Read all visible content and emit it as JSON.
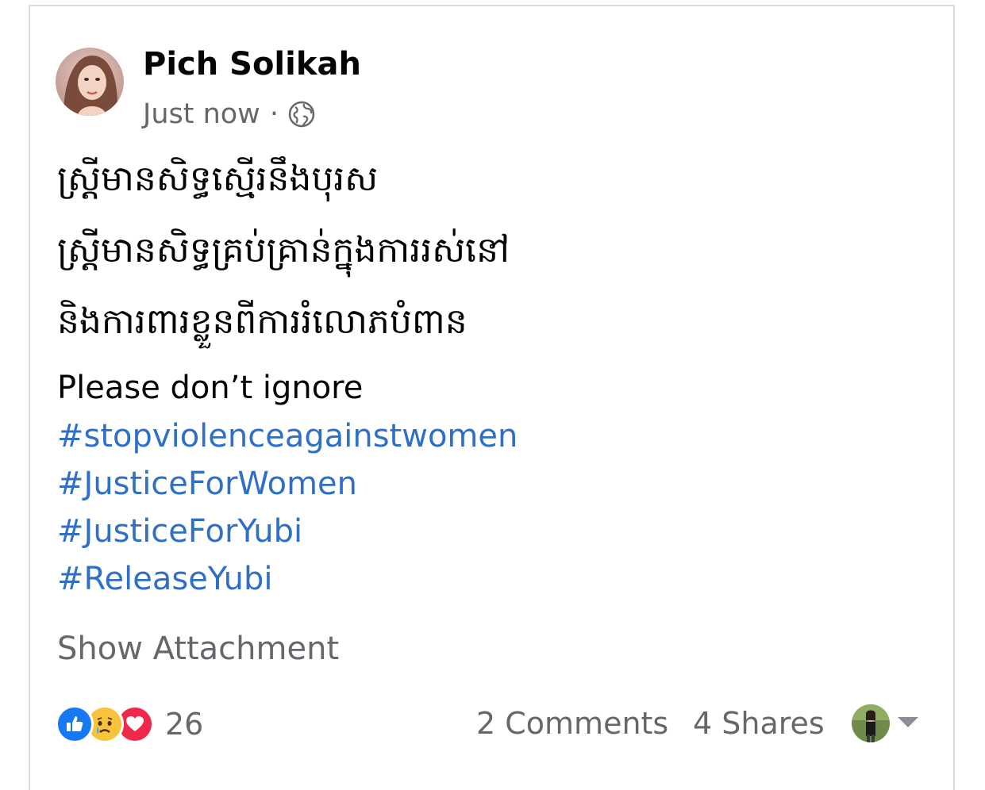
{
  "post": {
    "author": "Pich Solikah",
    "timestamp": "Just now",
    "separator": "·",
    "privacy_icon": "globe-icon",
    "body_khmer": [
      "ស្ត្រីមានសិទ្ធស្មើរនឹងបុរស",
      "ស្ត្រីមានសិទ្ធគ្រប់គ្រាន់ក្នុងការរស់នៅ",
      "និងការពារខ្លួនពីការរំលោភបំពាន"
    ],
    "body_english": "Please don’t ignore",
    "hashtags": [
      "#stopviolenceagainstwomen",
      "#JusticeForWomen",
      "#JusticeForYubi",
      "#ReleaseYubi"
    ],
    "show_attachment": "Show Attachment"
  },
  "footer": {
    "reaction_icons": [
      "like-icon",
      "sad-icon",
      "love-icon"
    ],
    "reaction_count": "26",
    "comments": "2 Comments",
    "shares": "4 Shares",
    "menu_icon": "caret-down-icon"
  },
  "colors": {
    "hashtag": "#2f6fc6",
    "muted": "#65676b",
    "like": "#1877f2",
    "love": "#f0284a",
    "sad": "#f7c33b"
  }
}
